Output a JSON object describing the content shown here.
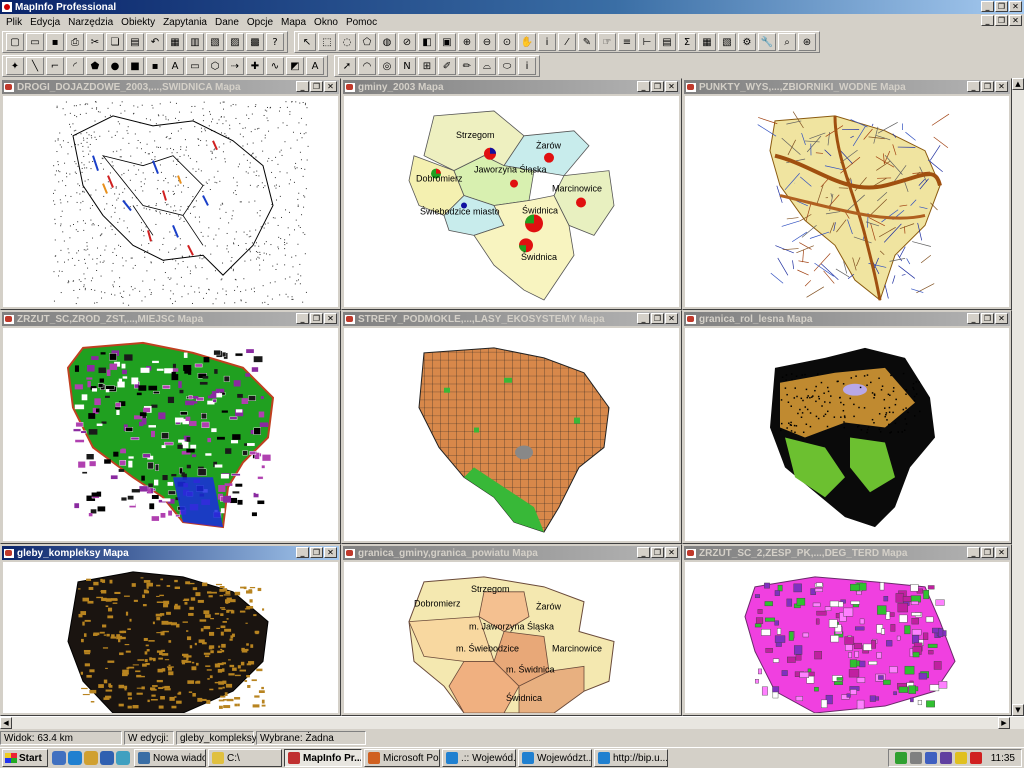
{
  "app": {
    "title": "MapInfo Professional"
  },
  "menu": [
    "Plik",
    "Edycja",
    "Narzędzia",
    "Obiekty",
    "Zapytania",
    "Dane",
    "Opcje",
    "Mapa",
    "Okno",
    "Pomoc"
  ],
  "window_controls": {
    "minimize": "_",
    "restore": "❐",
    "close": "✕"
  },
  "toolbar1": [
    {
      "name": "new-icon",
      "glyph": "▢"
    },
    {
      "name": "open-icon",
      "glyph": "▭"
    },
    {
      "name": "save-icon",
      "glyph": "▪"
    },
    {
      "name": "print-icon",
      "glyph": "⎙"
    },
    {
      "name": "cut-icon",
      "glyph": "✂"
    },
    {
      "name": "copy-icon",
      "glyph": "❏"
    },
    {
      "name": "paste-icon",
      "glyph": "▤"
    },
    {
      "name": "undo-icon",
      "glyph": "↶"
    },
    {
      "name": "new-mapper-icon",
      "glyph": "▦"
    },
    {
      "name": "new-browser-icon",
      "glyph": "▥"
    },
    {
      "name": "new-grapher-icon",
      "glyph": "▧"
    },
    {
      "name": "new-layout-icon",
      "glyph": "▨"
    },
    {
      "name": "new-redistrict-icon",
      "glyph": "▩"
    },
    {
      "name": "help-icon",
      "glyph": "?"
    }
  ],
  "toolbar1b": [
    {
      "name": "select-icon",
      "glyph": "↖"
    },
    {
      "name": "marquee-select-icon",
      "glyph": "⬚"
    },
    {
      "name": "radius-select-icon",
      "glyph": "◌"
    },
    {
      "name": "polygon-select-icon",
      "glyph": "⬠"
    },
    {
      "name": "boundary-select-icon",
      "glyph": "◍"
    },
    {
      "name": "unselect-icon",
      "glyph": "⊘"
    },
    {
      "name": "invert-selection-icon",
      "glyph": "◧"
    },
    {
      "name": "graph-select-icon",
      "glyph": "▣"
    },
    {
      "name": "zoom-in-icon",
      "glyph": "⊕"
    },
    {
      "name": "zoom-out-icon",
      "glyph": "⊖"
    },
    {
      "name": "change-view-icon",
      "glyph": "⊙"
    },
    {
      "name": "grabber-icon",
      "glyph": "✋"
    },
    {
      "name": "info-icon",
      "glyph": "i"
    },
    {
      "name": "hotlink-icon",
      "glyph": "⁄"
    },
    {
      "name": "label-icon",
      "glyph": "✎"
    },
    {
      "name": "drag-window-icon",
      "glyph": "☞"
    },
    {
      "name": "layer-control-icon",
      "glyph": "≡"
    },
    {
      "name": "ruler-icon",
      "glyph": "⊢"
    },
    {
      "name": "legend-icon",
      "glyph": "▤"
    },
    {
      "name": "statistics-icon",
      "glyph": "Σ"
    },
    {
      "name": "clip-region-icon",
      "glyph": "▦"
    },
    {
      "name": "set-clip-icon",
      "glyph": "▧"
    },
    {
      "name": "tools-icon",
      "glyph": "⚙"
    },
    {
      "name": "wrench-icon",
      "glyph": "🔧"
    },
    {
      "name": "show-hide-icon",
      "glyph": "⌕"
    },
    {
      "name": "scroll-icon",
      "glyph": "⊛"
    }
  ],
  "toolbar2": [
    {
      "name": "symbol-icon",
      "glyph": "✦"
    },
    {
      "name": "line-icon",
      "glyph": "╲"
    },
    {
      "name": "polyline-icon",
      "glyph": "⌐"
    },
    {
      "name": "arc-icon",
      "glyph": "◜"
    },
    {
      "name": "polygon-icon",
      "glyph": "⬟"
    },
    {
      "name": "ellipse-icon",
      "glyph": "●"
    },
    {
      "name": "rectangle-icon",
      "glyph": "■"
    },
    {
      "name": "rounded-rectangle-icon",
      "glyph": "▪"
    },
    {
      "name": "text-icon",
      "glyph": "A"
    },
    {
      "name": "frame-icon",
      "glyph": "▭"
    },
    {
      "name": "reshape-icon",
      "glyph": "⬡"
    },
    {
      "name": "add-node-icon",
      "glyph": "⇢"
    },
    {
      "name": "symbol-style-icon",
      "glyph": "✚"
    },
    {
      "name": "line-style-icon",
      "glyph": "∿"
    },
    {
      "name": "region-style-icon",
      "glyph": "◩"
    },
    {
      "name": "text-style-icon",
      "glyph": "A"
    }
  ],
  "toolbar2b": [
    {
      "name": "route-icon",
      "glyph": "➚"
    },
    {
      "name": "lasso-icon",
      "glyph": "◠"
    },
    {
      "name": "target-icon",
      "glyph": "◎"
    },
    {
      "name": "north-arrow-icon",
      "glyph": "N"
    },
    {
      "name": "scalebar-icon",
      "glyph": "⊞"
    },
    {
      "name": "pencil-icon",
      "glyph": "✐"
    },
    {
      "name": "brush-icon",
      "glyph": "✏"
    },
    {
      "name": "bridge-icon",
      "glyph": "⌓"
    },
    {
      "name": "capsule-icon",
      "glyph": "⬭"
    },
    {
      "name": "info-tool-icon",
      "glyph": "i"
    }
  ],
  "windows": [
    {
      "title": "DROGI_DOJAZDOWE_2003,...,SWIDNICA Mapa"
    },
    {
      "title": "gminy_2003 Mapa"
    },
    {
      "title": "PUNKTY_WYS,...,ZBIORNIKI_WODNE Mapa"
    },
    {
      "title": "ZRZUT_SC,ZROD_ZST,...,MIEJSC Mapa"
    },
    {
      "title": "STREFY_PODMOKLE,...,LASY_EKOSYSTEMY Mapa"
    },
    {
      "title": "granica_rol_lesna Mapa"
    },
    {
      "title": "gleby_kompleksy Mapa"
    },
    {
      "title": "granica_gminy,granica_powiatu Mapa"
    },
    {
      "title": "ZRZUT_SC_2,ZESP_PK,...,DEG_TERD Mapa"
    }
  ],
  "map_labels": {
    "gminy": [
      "Strzegom",
      "Żarów",
      "Jaworzyna Śląska",
      "Dobromierz",
      "Marcinowice",
      "Świebodzice miasto",
      "Świdnica",
      "Świdnica"
    ],
    "powiaty": [
      "Strzegom",
      "Dobromierz",
      "Żarów",
      "m. Jaworzyna Śląska",
      "m. Świebodzice",
      "Marcinowice",
      "m. Świdnica",
      "Świdnica"
    ]
  },
  "status": {
    "view": "Widok: 63.4 km",
    "edit_label": "W edycji:",
    "edit_value": "gleby_kompleksy",
    "selected": "Wybrane: Żadna"
  },
  "taskbar": {
    "start": "Start",
    "tasks": [
      "Nowa wiado...",
      "C:\\",
      "MapInfo Pr...",
      "Microsoft Po...",
      ".:: Wojewód...",
      "Województ...",
      "http://bip.u..."
    ],
    "clock": "11:35"
  },
  "colors": {
    "titlebar": "#0a246a",
    "face": "#d4d0c8",
    "mdi": "#808080"
  }
}
